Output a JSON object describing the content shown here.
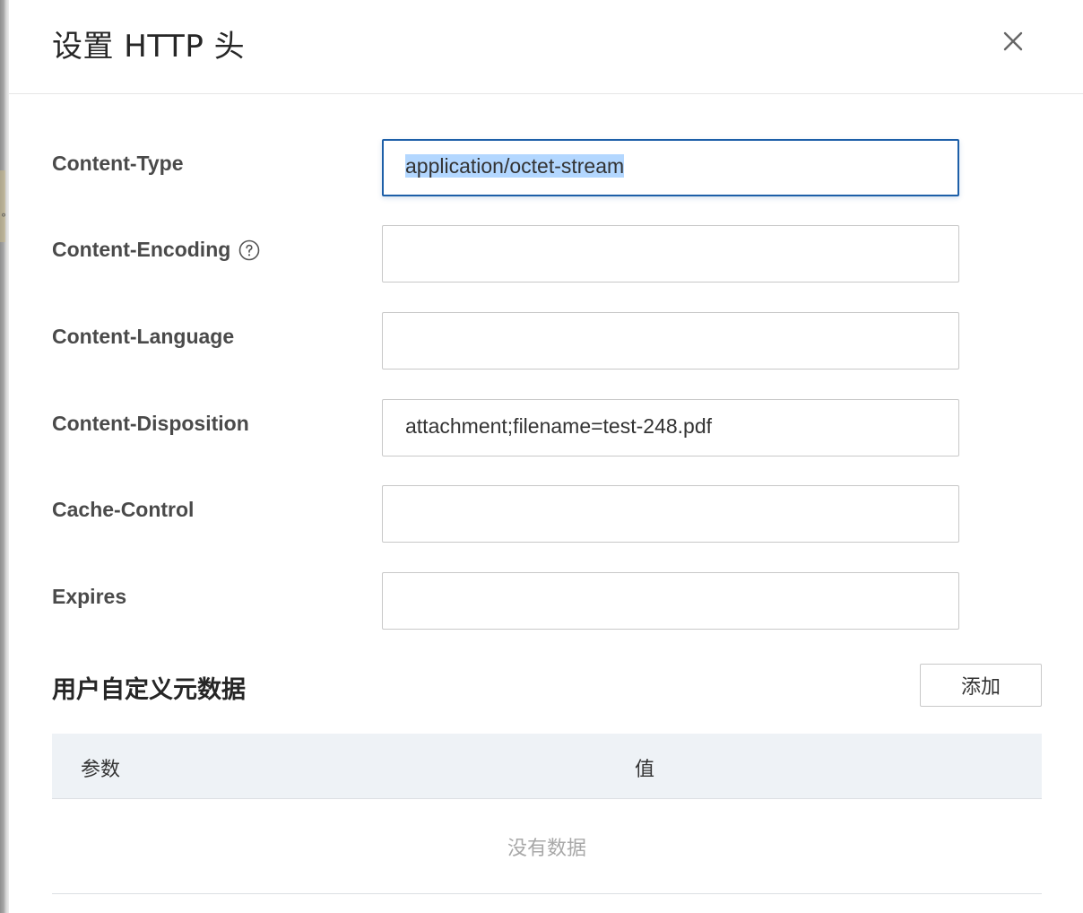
{
  "dialog": {
    "title": "设置 HTTP 头",
    "close_icon": "close-icon"
  },
  "form": {
    "fields": [
      {
        "label": "Content-Type",
        "value": "application/octet-stream",
        "placeholder": "",
        "focused": true,
        "selected": true
      },
      {
        "label": "Content-Encoding",
        "value": "",
        "placeholder": "",
        "help_icon": "question-circle-icon"
      },
      {
        "label": "Content-Language",
        "value": "",
        "placeholder": ""
      },
      {
        "label": "Content-Disposition",
        "value": "attachment;filename=test-248.pdf",
        "placeholder": ""
      },
      {
        "label": "Cache-Control",
        "value": "",
        "placeholder": ""
      },
      {
        "label": "Expires",
        "value": "",
        "placeholder": ""
      }
    ]
  },
  "metadata": {
    "title": "用户自定义元数据",
    "add_label": "添加",
    "columns": [
      "参数",
      "值"
    ],
    "empty_text": "没有数据"
  },
  "colors": {
    "focus_border": "#1d5fa8",
    "selection": "#b3d7ff",
    "table_header_bg": "#eef2f6"
  }
}
